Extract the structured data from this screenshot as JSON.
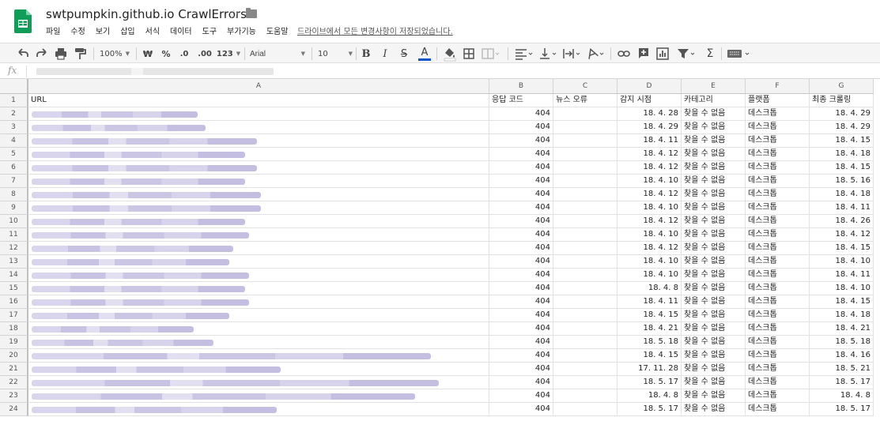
{
  "title": "swtpumpkin.github.io CrawlErrors",
  "menu": [
    "파일",
    "수정",
    "보기",
    "삽입",
    "서식",
    "데이터",
    "도구",
    "부가기능",
    "도움말"
  ],
  "saved_status": "드라이브에서 모든 변경사항이 저장되었습니다.",
  "toolbar": {
    "zoom": "100%",
    "currency": "₩",
    "percent": "%",
    "dec_decrease": ".0",
    "dec_increase": ".00",
    "more_formats": "123",
    "font": "Arial",
    "font_size": "10",
    "bold": "B",
    "italic": "I",
    "strike": "S",
    "text_color": "A"
  },
  "formula_bar": {
    "fx": "fx"
  },
  "columns": [
    "A",
    "B",
    "C",
    "D",
    "E",
    "F",
    "G"
  ],
  "headers": [
    "URL",
    "응답 코드",
    "뉴스 오류",
    "감지 시점",
    "카테고리",
    "플랫폼",
    "최종 크롤링"
  ],
  "rows": [
    {
      "n": "2",
      "code": "404",
      "detected": "18. 4. 28",
      "category": "찾을 수 없음",
      "platform": "데스크톱",
      "last": "18. 4. 29"
    },
    {
      "n": "3",
      "code": "404",
      "detected": "18. 4. 29",
      "category": "찾을 수 없음",
      "platform": "데스크톱",
      "last": "18. 4. 29"
    },
    {
      "n": "4",
      "code": "404",
      "detected": "18. 4. 11",
      "category": "찾을 수 없음",
      "platform": "데스크톱",
      "last": "18. 4. 15"
    },
    {
      "n": "5",
      "code": "404",
      "detected": "18. 4. 12",
      "category": "찾을 수 없음",
      "platform": "데스크톱",
      "last": "18. 4. 18"
    },
    {
      "n": "6",
      "code": "404",
      "detected": "18. 4. 12",
      "category": "찾을 수 없음",
      "platform": "데스크톱",
      "last": "18. 4. 15"
    },
    {
      "n": "7",
      "code": "404",
      "detected": "18. 4. 10",
      "category": "찾을 수 없음",
      "platform": "데스크톱",
      "last": "18. 5. 16"
    },
    {
      "n": "8",
      "code": "404",
      "detected": "18. 4. 12",
      "category": "찾을 수 없음",
      "platform": "데스크톱",
      "last": "18. 4. 18"
    },
    {
      "n": "9",
      "code": "404",
      "detected": "18. 4. 10",
      "category": "찾을 수 없음",
      "platform": "데스크톱",
      "last": "18. 4. 11"
    },
    {
      "n": "10",
      "code": "404",
      "detected": "18. 4. 12",
      "category": "찾을 수 없음",
      "platform": "데스크톱",
      "last": "18. 4. 26"
    },
    {
      "n": "11",
      "code": "404",
      "detected": "18. 4. 10",
      "category": "찾을 수 없음",
      "platform": "데스크톱",
      "last": "18. 4. 12"
    },
    {
      "n": "12",
      "code": "404",
      "detected": "18. 4. 12",
      "category": "찾을 수 없음",
      "platform": "데스크톱",
      "last": "18. 4. 15"
    },
    {
      "n": "13",
      "code": "404",
      "detected": "18. 4. 10",
      "category": "찾을 수 없음",
      "platform": "데스크톱",
      "last": "18. 4. 10"
    },
    {
      "n": "14",
      "code": "404",
      "detected": "18. 4. 10",
      "category": "찾을 수 없음",
      "platform": "데스크톱",
      "last": "18. 4. 11"
    },
    {
      "n": "15",
      "code": "404",
      "detected": "18. 4. 8",
      "category": "찾을 수 없음",
      "platform": "데스크톱",
      "last": "18. 4. 10"
    },
    {
      "n": "16",
      "code": "404",
      "detected": "18. 4. 11",
      "category": "찾을 수 없음",
      "platform": "데스크톱",
      "last": "18. 4. 15"
    },
    {
      "n": "17",
      "code": "404",
      "detected": "18. 4. 15",
      "category": "찾을 수 없음",
      "platform": "데스크톱",
      "last": "18. 4. 18"
    },
    {
      "n": "18",
      "code": "404",
      "detected": "18. 4. 21",
      "category": "찾을 수 없음",
      "platform": "데스크톱",
      "last": "18. 4. 21"
    },
    {
      "n": "19",
      "code": "404",
      "detected": "18. 5. 18",
      "category": "찾을 수 없음",
      "platform": "데스크톱",
      "last": "18. 5. 18"
    },
    {
      "n": "20",
      "code": "404",
      "detected": "18. 4. 15",
      "category": "찾을 수 없음",
      "platform": "데스크톱",
      "last": "18. 4. 16"
    },
    {
      "n": "21",
      "code": "404",
      "detected": "17. 11. 28",
      "category": "찾을 수 없음",
      "platform": "데스크톱",
      "last": "18. 5. 21"
    },
    {
      "n": "22",
      "code": "404",
      "detected": "18. 5. 17",
      "category": "찾을 수 없음",
      "platform": "데스크톱",
      "last": "18. 5. 17"
    },
    {
      "n": "23",
      "code": "404",
      "detected": "18. 4. 8",
      "category": "찾을 수 없음",
      "platform": "데스크톱",
      "last": "18. 4. 8"
    },
    {
      "n": "24",
      "code": "404",
      "detected": "18. 5. 17",
      "category": "찾을 수 없음",
      "platform": "데스크톱",
      "last": "18. 5. 17"
    }
  ]
}
